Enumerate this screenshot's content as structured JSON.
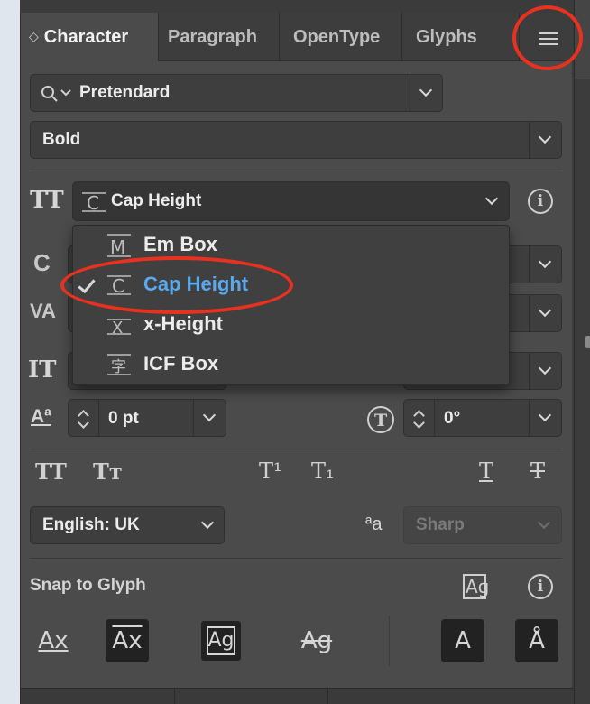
{
  "tabs": [
    {
      "label": "Character",
      "active": true
    },
    {
      "label": "Paragraph",
      "active": false
    },
    {
      "label": "OpenType",
      "active": false
    },
    {
      "label": "Glyphs",
      "active": false
    }
  ],
  "font_family": {
    "value": "Pretendard",
    "icon": "search-icon"
  },
  "font_style": {
    "value": "Bold"
  },
  "alignment": {
    "value": "Cap Height",
    "icon": "cap-height-icon"
  },
  "popup": {
    "items": [
      {
        "label": "Em Box",
        "icon": "em-box-icon",
        "glyph": "M",
        "selected": false
      },
      {
        "label": "Cap Height",
        "icon": "cap-height-icon",
        "glyph": "C",
        "selected": true
      },
      {
        "label": "x-Height",
        "icon": "x-height-icon",
        "glyph": "X",
        "selected": false
      },
      {
        "label": "ICF Box",
        "icon": "icf-box-icon",
        "glyph": "字",
        "selected": false
      }
    ]
  },
  "baseline_shift": {
    "value": "0 pt"
  },
  "character_rotation": {
    "value": "0°"
  },
  "language": {
    "value": "English: UK"
  },
  "antialiasing": {
    "value": "Sharp",
    "disabled": true
  },
  "snap": {
    "label": "Snap to Glyph"
  },
  "style_buttons": {
    "all_caps": "TT",
    "small_caps": "Tт",
    "superscript": "T¹",
    "subscript": "T₁",
    "underline": "T",
    "strikethrough": "T"
  },
  "glyph_labels": {
    "snap_icon": "Ag",
    "antialias_icon": "ªa",
    "baseline_icon": "Aª",
    "leading_icon": "IT",
    "tracking_icon": "VA",
    "size_icon": "C",
    "type_icon": "TT",
    "info": "i"
  },
  "colors": {
    "panel_bg": "#4b4b4b",
    "field_bg": "#3e3e3e",
    "selected_text": "#5aa9ee",
    "annotation": "#e8311f"
  }
}
